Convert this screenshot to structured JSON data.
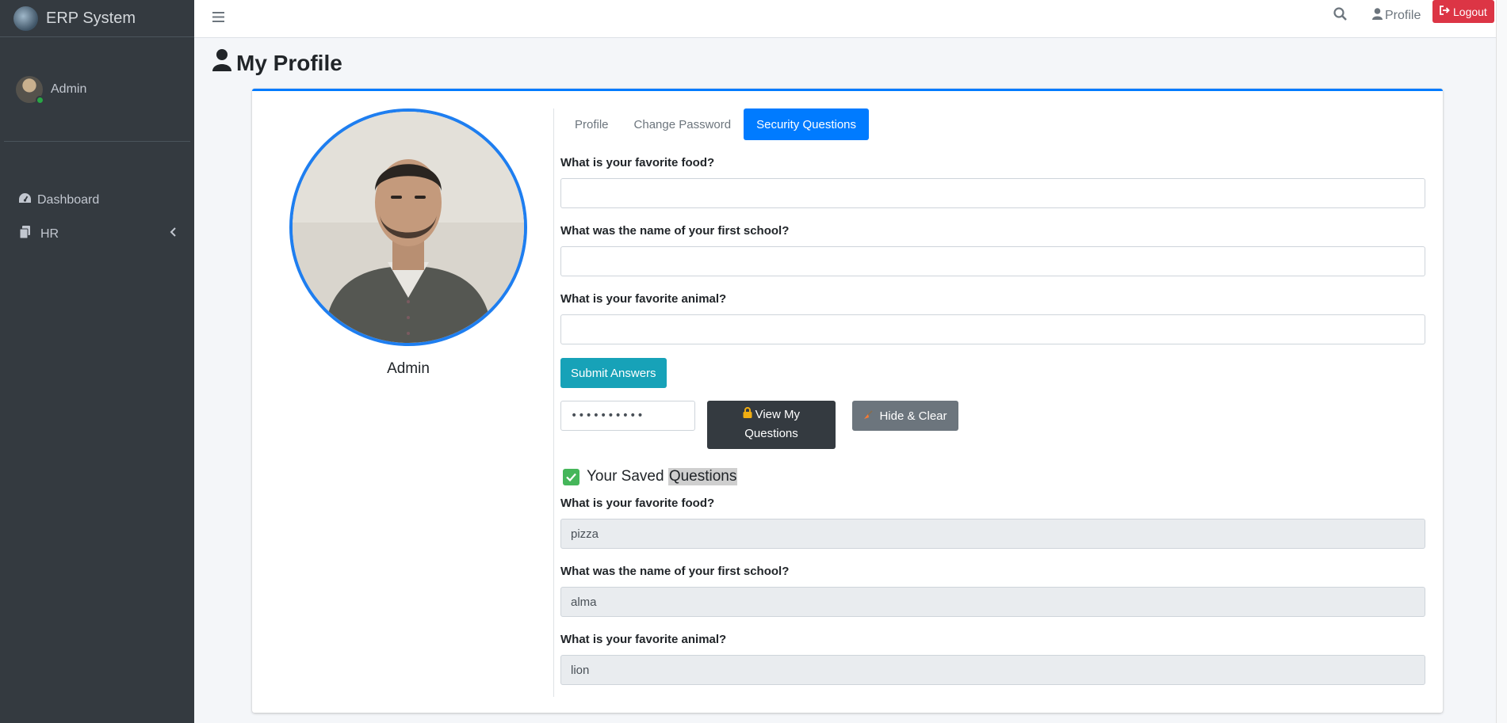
{
  "brand": {
    "title": "ERP System"
  },
  "sidebar": {
    "user_name": "Admin",
    "items": [
      {
        "label": "Dashboard",
        "icon": "tachometer-icon"
      },
      {
        "label": "HR",
        "icon": "copy-icon"
      }
    ]
  },
  "header": {
    "profile_label": "Profile",
    "logout_label": "Logout"
  },
  "page": {
    "title": "My Profile"
  },
  "profile": {
    "name": "Admin"
  },
  "tabs": [
    {
      "label": "Profile",
      "active": false
    },
    {
      "label": "Change Password",
      "active": false
    },
    {
      "label": "Security Questions",
      "active": true
    }
  ],
  "security_form": {
    "questions": [
      {
        "label": "What is your favorite food?",
        "value": ""
      },
      {
        "label": "What was the name of your first school?",
        "value": ""
      },
      {
        "label": "What is your favorite animal?",
        "value": ""
      }
    ],
    "submit_label": "Submit Answers",
    "password_value": "••••••••••",
    "view_label_line1": "View My",
    "view_label_line2": "Questions",
    "hide_label": "Hide & Clear"
  },
  "saved": {
    "title_part1": "Your Saved ",
    "title_part2": "Questions",
    "answers": [
      {
        "label": "What is your favorite food?",
        "value": "pizza"
      },
      {
        "label": "What was the name of your first school?",
        "value": "alma"
      },
      {
        "label": "What is your favorite animal?",
        "value": "lion"
      }
    ]
  },
  "colors": {
    "primary": "#007bff",
    "info": "#17a2b8",
    "danger": "#dc3545",
    "dark": "#343a40",
    "secondary": "#6c757d",
    "success": "#28a745"
  }
}
